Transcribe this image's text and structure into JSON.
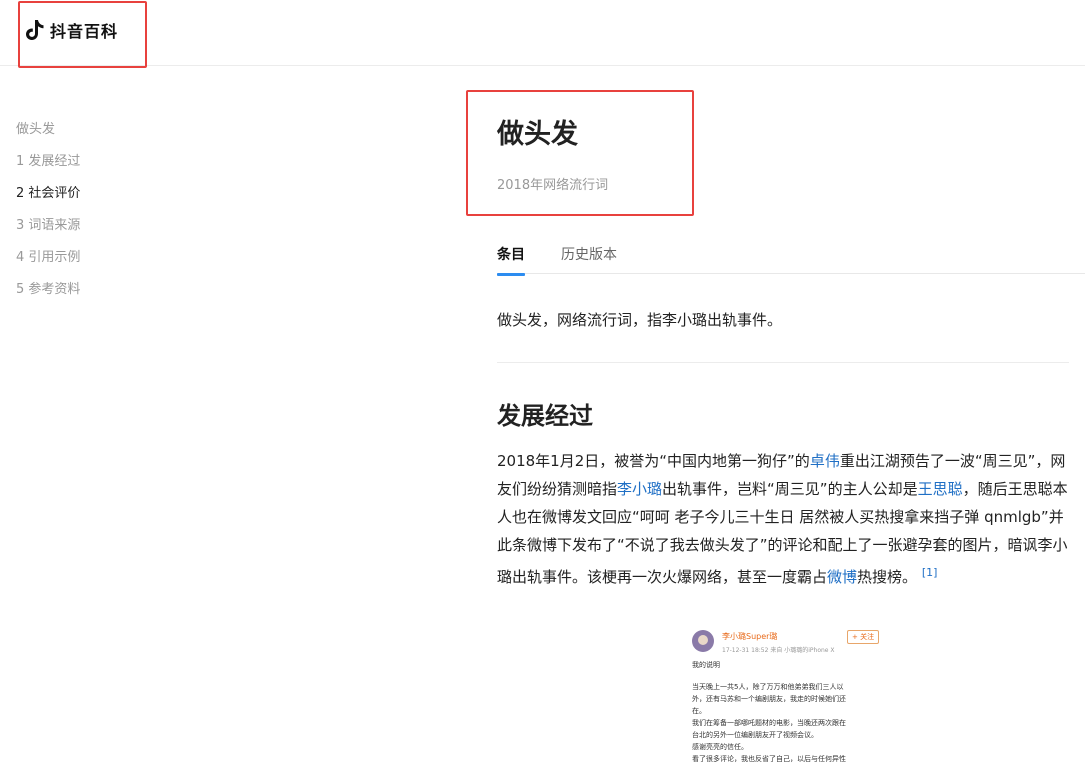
{
  "brand": {
    "name": "抖音百科",
    "icon": "tiktok-note-icon"
  },
  "toc": {
    "items": [
      "做头发",
      "1 发展经过",
      "2 社会评价",
      "3 词语来源",
      "4 引用示例",
      "5 参考资料"
    ],
    "active_index": 2
  },
  "entry": {
    "title": "做头发",
    "subtitle": "2018年网络流行词"
  },
  "tabs": [
    {
      "label": "条目"
    },
    {
      "label": "历史版本"
    }
  ],
  "summary": "做头发，网络流行词，指李小璐出轨事件。",
  "section": {
    "heading": "发展经过",
    "p1": "2018年1月2日，被誉为“中国内地第一狗仔”的",
    "link1": "卓伟",
    "p2": "重出江湖预告了一波“周三见”，网友们纷纷猜测暗指",
    "link2": "李小璐",
    "p3": "出轨事件，岂料“周三见”的主人公却是",
    "link3": "王思聪",
    "p4": "，随后王思聪本人也在微博发文回应“呵呵 老子今儿三十生日 居然被人买热搜拿来挡子弹 qnmlgb”并此条微博下发布了“不说了我去做头发了”的评论和配上了一张避孕套的图片，暗讽李小璐出轨事件。该梗再一次火爆网络，甚至一度霸占",
    "link4": "微博",
    "p5": "热搜榜。",
    "ref": "[1]"
  },
  "weibo": {
    "name": "李小璐Super璐",
    "meta": "17-12-31 18:52  来自 小璐璐的iPhone X",
    "follow": "+ 关注",
    "lines": [
      "我的说明",
      "",
      "当天晚上一共5人，除了万万和他弟弟我们三人以",
      "外，还有马苏和一个编剧朋友，我走的时候她们还",
      "在。",
      "我们在筹备一部哪吒题材的电影，当晚还两次跟在",
      "台北的另外一位编剧朋友开了视频会议。",
      "感谢亮亮的信任。",
      "看了很多评论，我也反省了自己，以后与任何异性"
    ]
  }
}
